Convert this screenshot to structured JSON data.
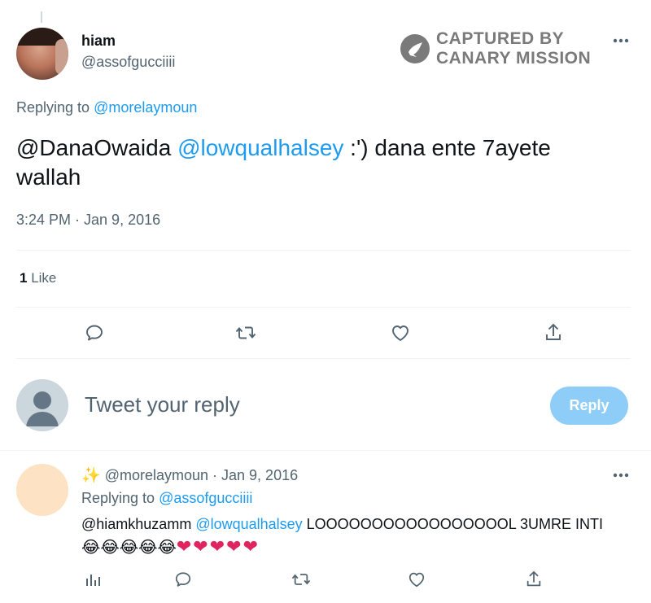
{
  "tweet": {
    "author_name": "hiam",
    "author_handle": "@assofgucciiii",
    "replying_prefix": "Replying to",
    "replying_to": "@morelaymoun",
    "text_mention1": "@DanaOwaida",
    "text_mention2": "@lowqualhalsey",
    "text_body": " :') dana ente 7ayete wallah",
    "timestamp": "3:24 PM · Jan 9, 2016",
    "likes_count": "1",
    "likes_label": "Like"
  },
  "watermark": {
    "line1": "CAPTURED BY",
    "line2": "CANARY MISSION"
  },
  "composer": {
    "placeholder": "Tweet your reply",
    "reply_button": "Reply"
  },
  "reply_tweet": {
    "sparkle": "✨",
    "handle": "@morelaymoun",
    "date": "· Jan 9, 2016",
    "replying_prefix": "Replying to",
    "replying_to": "@assofgucciiii",
    "mention1": "@hiamkhuzamm",
    "mention2": "@lowqualhalsey",
    "text": " LOOOOOOOOOOOOOOOOOL 3UMRE INTI",
    "emojis_laugh": "😂😂😂😂😂",
    "emojis_heart": "❤❤❤❤❤"
  },
  "colors": {
    "accent": "#1d9bf0",
    "reply_button_bg": "#8ecdf8",
    "heart": "#e0245e"
  },
  "icons": [
    "more-icon",
    "canary-logo-icon",
    "reply-icon",
    "retweet-icon",
    "like-icon",
    "share-icon",
    "analytics-icon"
  ]
}
